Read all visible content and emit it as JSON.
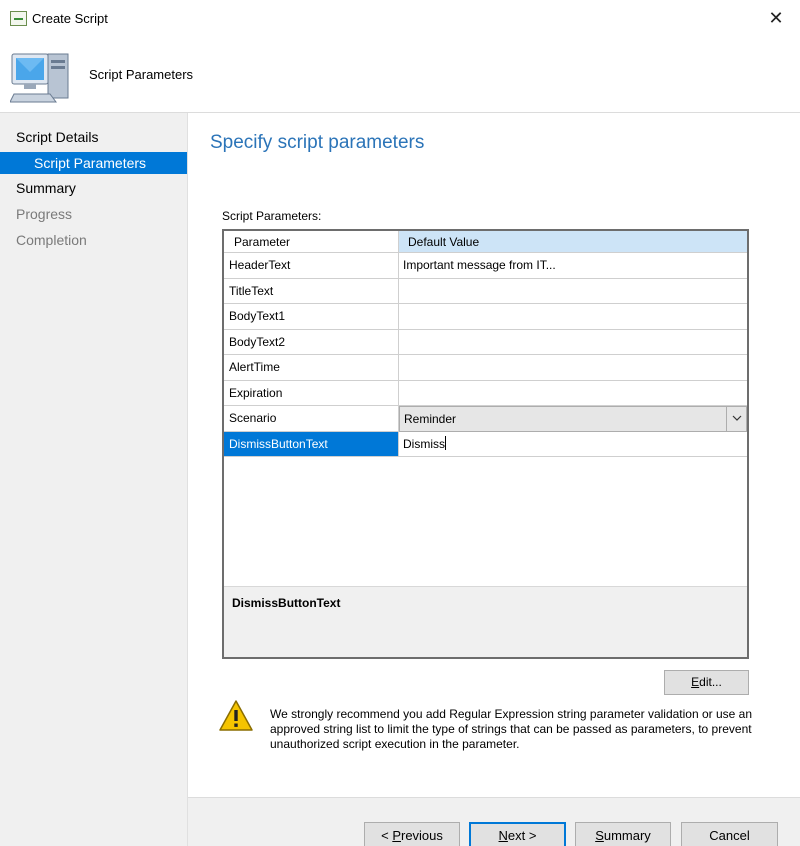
{
  "window": {
    "title": "Create Script",
    "close_glyph": "✕"
  },
  "header": {
    "title": "Script Parameters",
    "icon": "computer-icon"
  },
  "sidebar": {
    "items": [
      {
        "label": "Script Details",
        "state": "normal"
      },
      {
        "label": "Script Parameters",
        "state": "active"
      },
      {
        "label": "Summary",
        "state": "normal"
      },
      {
        "label": "Progress",
        "state": "disabled"
      },
      {
        "label": "Completion",
        "state": "disabled"
      }
    ]
  },
  "main": {
    "title": "Specify script parameters",
    "grid_label": "Script Parameters:",
    "columns": [
      "Parameter",
      "Default Value"
    ],
    "rows": [
      {
        "name": "HeaderText",
        "value": "Important message from IT..."
      },
      {
        "name": "TitleText",
        "value": ""
      },
      {
        "name": "BodyText1",
        "value": ""
      },
      {
        "name": "BodyText2",
        "value": ""
      },
      {
        "name": "AlertTime",
        "value": ""
      },
      {
        "name": "Expiration",
        "value": ""
      },
      {
        "name": "Scenario",
        "value": "Reminder"
      },
      {
        "name": "DismissButtonText",
        "value": "Dismiss"
      }
    ],
    "description_title": "DismissButtonText",
    "edit_button": {
      "prefix": "",
      "accel": "E",
      "suffix": "dit..."
    },
    "warning_text": "We strongly recommend you add Regular Expression string parameter validation or use an approved string list to limit the type of strings that can be passed as parameters, to prevent unauthorized script execution in the parameter."
  },
  "footer": {
    "previous": {
      "prefix": "< ",
      "accel": "P",
      "suffix": "revious"
    },
    "next": {
      "prefix": "",
      "accel": "N",
      "suffix": "ext >"
    },
    "summary": {
      "prefix": "",
      "accel": "S",
      "suffix": "ummary"
    },
    "cancel": {
      "prefix": "Cancel",
      "accel": "",
      "suffix": ""
    }
  },
  "colors": {
    "accent": "#0078d7",
    "title_blue": "#2b74b8",
    "header_cell": "#cde4f7",
    "warning_yellow": "#f5c400"
  }
}
